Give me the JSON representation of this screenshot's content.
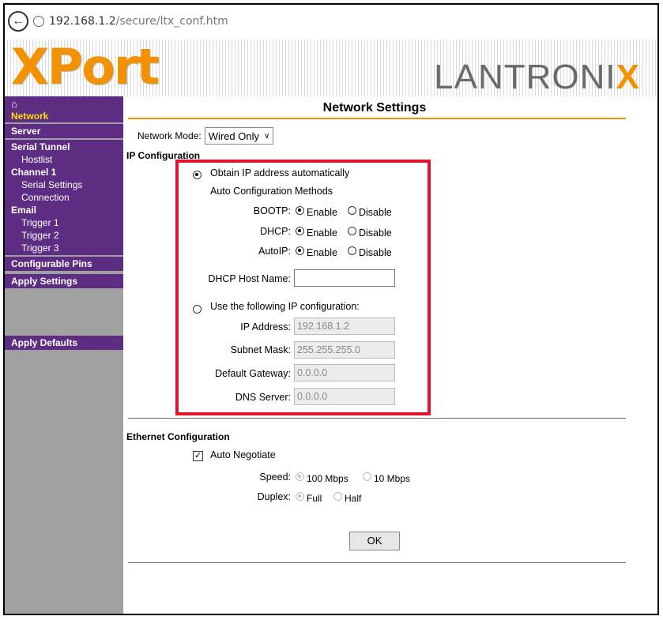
{
  "browser": {
    "url_host": "192.168.1.2",
    "url_path": "/secure/ltx_conf.htm"
  },
  "banner": {
    "product_logo": "XPort",
    "brand_logo": "LANTRONIX"
  },
  "sidebar": {
    "home_icon": "home-icon",
    "items": [
      {
        "label": "Network",
        "active": true
      },
      {
        "label": "Server"
      },
      {
        "label": "Serial Tunnel",
        "children": [
          "Hostlist"
        ]
      },
      {
        "label": "Channel 1",
        "children": [
          "Serial Settings",
          "Connection"
        ]
      },
      {
        "label": "Email",
        "children": [
          "Trigger 1",
          "Trigger 2",
          "Trigger 3"
        ]
      },
      {
        "label": "Configurable Pins"
      },
      {
        "label": "Apply Settings"
      },
      {
        "label": "Apply Defaults"
      }
    ]
  },
  "main": {
    "title": "Network Settings",
    "network_mode_label": "Network Mode:",
    "network_mode_value": "Wired Only",
    "ip_config": {
      "heading": "IP Configuration",
      "auto_option": "Obtain IP address automatically",
      "auto_methods_label": "Auto Configuration Methods",
      "enable_label": "Enable",
      "disable_label": "Disable",
      "methods": [
        {
          "label": "BOOTP:",
          "value": "Enable"
        },
        {
          "label": "DHCP:",
          "value": "Enable"
        },
        {
          "label": "AutoIP:",
          "value": "Enable"
        }
      ],
      "dhcp_host_label": "DHCP Host Name:",
      "dhcp_host_value": "",
      "manual_option": "Use the following IP configuration:",
      "selected_option": "auto",
      "fields": [
        {
          "label": "IP Address:",
          "value": "192.168.1.2"
        },
        {
          "label": "Subnet Mask:",
          "value": "255.255.255.0"
        },
        {
          "label": "Default Gateway:",
          "value": "0.0.0.0"
        },
        {
          "label": "DNS Server:",
          "value": "0.0.0.0"
        }
      ]
    },
    "ethernet": {
      "heading": "Ethernet Configuration",
      "auto_negotiate_label": "Auto Negotiate",
      "auto_negotiate_checked": true,
      "speed_label": "Speed:",
      "speed_options": [
        "100 Mbps",
        "10 Mbps"
      ],
      "speed_value": "100 Mbps",
      "duplex_label": "Duplex:",
      "duplex_options": [
        "Full",
        "Half"
      ],
      "duplex_value": "Full"
    },
    "ok_label": "OK"
  },
  "colors": {
    "accent_orange": "#f39200",
    "nav_purple": "#5c2d83",
    "nav_active": "#ffdd00",
    "highlight_red": "#e0142a"
  }
}
